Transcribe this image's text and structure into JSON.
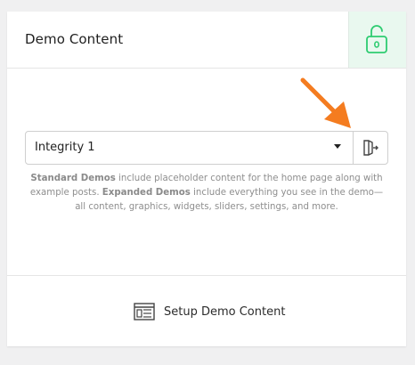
{
  "header": {
    "title": "Demo Content",
    "lock_icon": "unlock-icon",
    "accent_color": "#2ecc71"
  },
  "demo_select": {
    "selected_value": "Integrity 1",
    "caret_icon": "caret-down-icon",
    "import_icon": "import-icon"
  },
  "help": {
    "standard_label": "Standard Demos",
    "standard_text": " include placeholder content for the home page along with example posts. ",
    "expanded_label": "Expanded Demos",
    "expanded_text": " include everything you see in the demo—all content, graphics, widgets, sliders, settings, and more."
  },
  "footer": {
    "setup_label": "Setup Demo Content",
    "setup_icon": "layout-icon"
  },
  "annotation": {
    "arrow_color": "#f47c20"
  }
}
